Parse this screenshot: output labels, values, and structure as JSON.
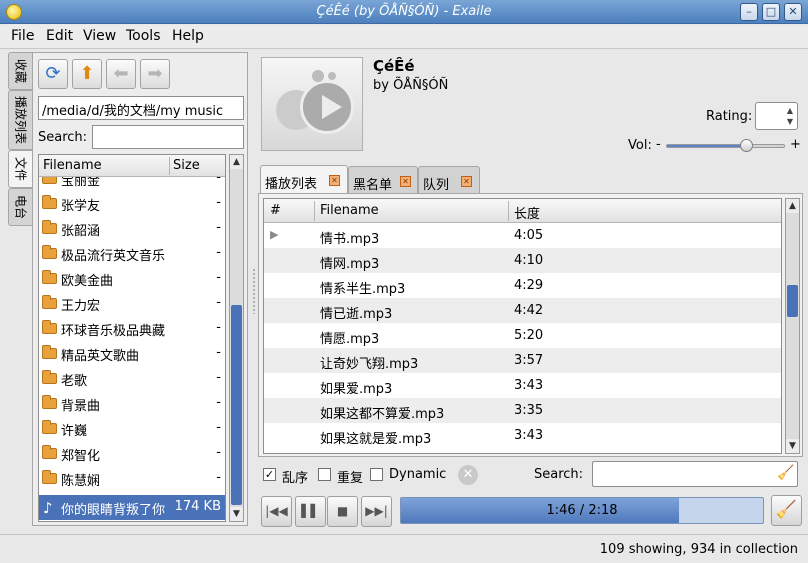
{
  "window": {
    "title": "ÇéÊé (by ÕÅÑ§ÓÑ) - Exaile",
    "minimize_glyph": "–",
    "maximize_glyph": "□",
    "close_glyph": "✕"
  },
  "menu": [
    "File",
    "Edit",
    "View",
    "Tools",
    "Help"
  ],
  "side_tabs": [
    "收藏",
    "播放列表",
    "文件",
    "电台"
  ],
  "file_browser": {
    "path": "/media/d/我的文档/my music",
    "search_label": "Search:",
    "search_value": "",
    "columns": [
      "Filename",
      "Size"
    ],
    "rows": [
      {
        "name": "宝丽金",
        "size": "-"
      },
      {
        "name": "张学友",
        "size": "-"
      },
      {
        "name": "张韶涵",
        "size": "-"
      },
      {
        "name": "极品流行英文音乐",
        "size": "-"
      },
      {
        "name": "欧美金曲",
        "size": "-"
      },
      {
        "name": "王力宏",
        "size": "-"
      },
      {
        "name": "环球音乐极品典藏",
        "size": "-"
      },
      {
        "name": "精品英文歌曲",
        "size": "-"
      },
      {
        "name": "老歌",
        "size": "-"
      },
      {
        "name": "背景曲",
        "size": "-"
      },
      {
        "name": "许巍",
        "size": "-"
      },
      {
        "name": "郑智化",
        "size": "-"
      },
      {
        "name": "陈慧娴",
        "size": "-"
      },
      {
        "name": "你的眼睛背叛了你",
        "size": "174 KB",
        "selected": true
      }
    ]
  },
  "now_playing": {
    "title": "ÇéÊé",
    "artist": "by ÕÅÑ§ÓÑ",
    "rating_label": "Rating:",
    "volume_label": "Vol:",
    "volume_minus": "-",
    "volume_plus": "+",
    "volume_level": 0.68
  },
  "playlist_tabs": [
    "播放列表",
    "黑名单",
    "队列"
  ],
  "playlist": {
    "columns": [
      "#",
      "Filename",
      "长度"
    ],
    "rows": [
      {
        "file": "情书.mp3",
        "length": "4:05",
        "playing": true
      },
      {
        "file": "情网.mp3",
        "length": "4:10"
      },
      {
        "file": "情系半生.mp3",
        "length": "4:29"
      },
      {
        "file": "情已逝.mp3",
        "length": "4:42"
      },
      {
        "file": "情愿.mp3",
        "length": "5:20"
      },
      {
        "file": "让奇妙飞翔.mp3",
        "length": "3:57"
      },
      {
        "file": "如果爱.mp3",
        "length": "3:43"
      },
      {
        "file": "如果这都不算爱.mp3",
        "length": "3:35"
      },
      {
        "file": "如果这就是爱.mp3",
        "length": "3:43"
      }
    ]
  },
  "options": {
    "shuffle_label": "乱序",
    "shuffle_checked": true,
    "repeat_label": "重复",
    "repeat_checked": false,
    "dynamic_label": "Dynamic",
    "dynamic_checked": false,
    "search_label": "Search:",
    "search_value": ""
  },
  "transport": {
    "progress_text": "1:46 / 2:18",
    "progress_fraction": 0.768
  },
  "status": {
    "text": "109 showing, 934 in collection"
  }
}
